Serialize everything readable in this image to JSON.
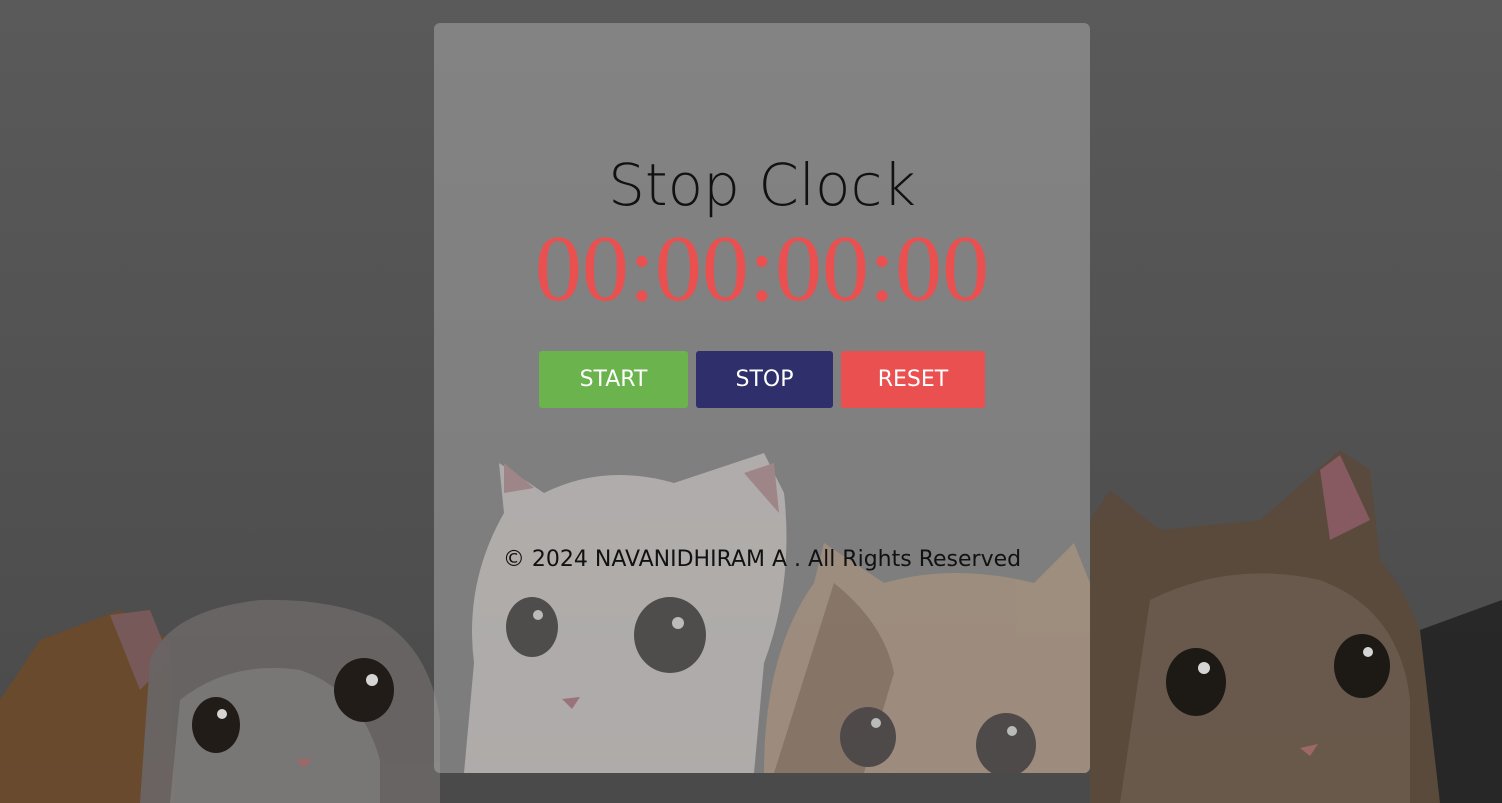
{
  "app": {
    "title": "Stop Clock"
  },
  "timer": {
    "display": "00:00:00:00",
    "color": "#ea5050"
  },
  "controls": {
    "start_label": "START",
    "stop_label": "STOP",
    "reset_label": "RESET",
    "start_color": "#6ab34d",
    "stop_color": "#2f2f6b",
    "reset_color": "#ea5050"
  },
  "footer": {
    "text": "© 2024 NAVANIDHIRAM A . All Rights Reserved"
  },
  "background": {
    "description_icon": "cats-illustration"
  }
}
